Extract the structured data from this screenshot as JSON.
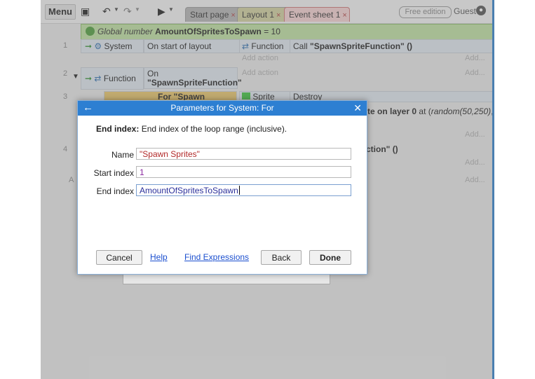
{
  "toolbar": {
    "menu_label": "Menu",
    "tabs": [
      {
        "label": "Start page"
      },
      {
        "label": "Layout 1"
      },
      {
        "label": "Event sheet 1"
      }
    ],
    "free_edition": "Free edition",
    "guest": "Guest"
  },
  "events": {
    "global_prefix": "Global number",
    "global_name": "AmountOfSpritesToSpawn",
    "global_value": "= 10",
    "rows": [
      {
        "num": "1",
        "condition_object": "System",
        "condition": "On start of layout",
        "action_object": "Function",
        "action_prefix": "Call",
        "action_value": "\"SpawnSpriteFunction\" ()",
        "add_action": "Add action",
        "add": "Add..."
      },
      {
        "num": "2",
        "condition_object": "Function",
        "condition_line1": "On",
        "condition_line2": "\"SpawnSpriteFunction\"",
        "add_action": "Add action",
        "add": "Add..."
      },
      {
        "num": "3",
        "sub_condition": "For \"Spawn Sprites\"",
        "action_object": "Sprite",
        "action": "Destroy",
        "partial_text_1": "te on layer",
        "partial_bold": "0",
        "partial_text_2": "at (",
        "partial_italic": "random(50,250)",
        "partial_end": ",",
        "add": "Add..."
      },
      {
        "num": "4",
        "partial_action": "ction\" ()",
        "add": "Add..."
      }
    ],
    "add_bottom": "Add..."
  },
  "dialog": {
    "title": "Parameters for System: For",
    "help_label": "End index:",
    "help_text": "End index of the loop range (inclusive).",
    "fields": [
      {
        "label": "Name",
        "value": "\"Spawn Sprites\""
      },
      {
        "label": "Start index",
        "value": "1"
      },
      {
        "label": "End index",
        "value": "AmountOfSpritesToSpawn"
      }
    ],
    "buttons": {
      "cancel": "Cancel",
      "help": "Help",
      "find_expressions": "Find Expressions",
      "back": "Back",
      "done": "Done"
    }
  },
  "icons": {
    "back": "arrow-left-icon",
    "close": "close-icon",
    "save": "save-icon",
    "undo": "undo-icon",
    "redo": "redo-icon",
    "run": "play-icon",
    "user": "user-icon"
  },
  "colors": {
    "dialog_title_bg": "#2d7fd2",
    "global_row_bg": "#bfe0a1",
    "string_param": "#b22a2a",
    "number_param": "#8a2aa0",
    "expression_param": "#2a2f9a",
    "link": "#1b4fcf"
  }
}
